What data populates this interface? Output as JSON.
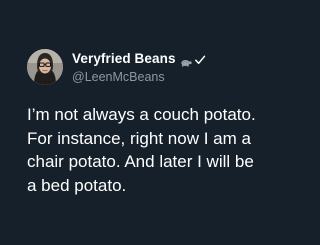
{
  "tweet": {
    "display_name": "Veryfried Beans",
    "name_emoji_icon": "turtle-emoji-icon",
    "verified_icon": "checkmark-icon",
    "handle": "@LeenMcBeans",
    "text_lines": [
      "I’m not always a couch potato.",
      "For instance, right now I am a",
      "chair potato. And later I will be",
      "a bed potato."
    ]
  },
  "colors": {
    "background": "#15202b",
    "text_primary": "#ffffff",
    "text_secondary": "#8b98a5"
  }
}
